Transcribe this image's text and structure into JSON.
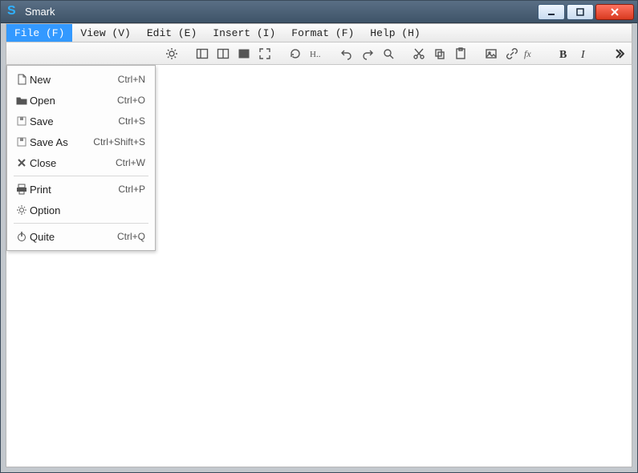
{
  "window": {
    "title": "Smark"
  },
  "menubar": {
    "file": "File (F)",
    "view": "View (V)",
    "edit": "Edit (E)",
    "insert": "Insert (I)",
    "format": "Format (F)",
    "help": "Help (H)"
  },
  "file_menu": {
    "new": {
      "label": "New",
      "shortcut": "Ctrl+N"
    },
    "open": {
      "label": "Open",
      "shortcut": "Ctrl+O"
    },
    "save": {
      "label": "Save",
      "shortcut": "Ctrl+S"
    },
    "save_as": {
      "label": "Save As",
      "shortcut": "Ctrl+Shift+S"
    },
    "close": {
      "label": "Close",
      "shortcut": "Ctrl+W"
    },
    "print": {
      "label": "Print",
      "shortcut": "Ctrl+P"
    },
    "option": {
      "label": "Option",
      "shortcut": ""
    },
    "quite": {
      "label": "Quite",
      "shortcut": "Ctrl+Q"
    }
  }
}
